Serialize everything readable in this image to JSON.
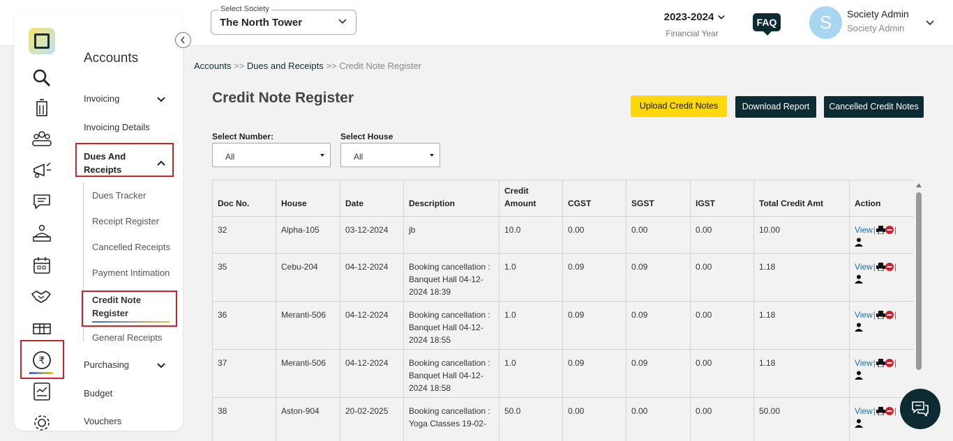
{
  "header": {
    "society_label": "Select Society",
    "society_value": "The North Tower",
    "financial_year": "2023-2024",
    "financial_year_label": "Financial Year",
    "faq_label": "FAQ",
    "avatar_initial": "S",
    "user_name": "Society Admin",
    "user_role": "Society Admin"
  },
  "sidebar": {
    "section_title": "Accounts",
    "items": {
      "invoicing": "Invoicing",
      "invoicing_details": "Invoicing Details",
      "dues_and_receipts": "Dues And Receipts",
      "dues_tracker": "Dues Tracker",
      "receipt_register": "Receipt Register",
      "cancelled_receipts": "Cancelled Receipts",
      "payment_intimation": "Payment Intimation",
      "credit_note_register": "Credit Note Register",
      "general_receipts": "General Receipts",
      "purchasing": "Purchasing",
      "budget": "Budget",
      "vouchers": "Vouchers"
    },
    "icons": [
      "search-icon",
      "building-icon",
      "members-icon",
      "announcement-icon",
      "chat-icon",
      "helpdesk-icon",
      "calendar-icon",
      "handshake-icon",
      "package-icon",
      "rupee-icon",
      "report-icon",
      "settings-icon"
    ]
  },
  "breadcrumb": {
    "accounts": "Accounts",
    "sep1": ">>",
    "dues": "Dues and Receipts",
    "sep2": ">>",
    "current": "Credit Note Register"
  },
  "page": {
    "title": "Credit Note Register",
    "upload_button": "Upload Credit Notes",
    "download_button": "Download Report",
    "cancelled_button": "Cancelled Credit Notes"
  },
  "filters": {
    "number_label": "Select Number:",
    "number_value": "All",
    "house_label": "Select House",
    "house_value": "All"
  },
  "table": {
    "headers": [
      "Doc No.",
      "House",
      "Date",
      "Description",
      "Credit Amount",
      "CGST",
      "SGST",
      "IGST",
      "Total Credit Amt",
      "Action"
    ],
    "action_view": "View",
    "action_sep": "|",
    "rows": [
      {
        "doc": "32",
        "house": "Alpha-105",
        "date": "03-12-2024",
        "desc": "jb",
        "credit": "10.0",
        "cgst": "0.00",
        "sgst": "0.00",
        "igst": "0.00",
        "total": "10.00"
      },
      {
        "doc": "35",
        "house": "Cebu-204",
        "date": "04-12-2024",
        "desc": "Booking cancellation : Banquet Hall 04-12-2024 18:39",
        "credit": "1.0",
        "cgst": "0.09",
        "sgst": "0.09",
        "igst": "0.00",
        "total": "1.18"
      },
      {
        "doc": "36",
        "house": "Meranti-506",
        "date": "04-12-2024",
        "desc": "Booking cancellation : Banquet Hall 04-12-2024 18:55",
        "credit": "1.0",
        "cgst": "0.09",
        "sgst": "0.09",
        "igst": "0.00",
        "total": "1.18"
      },
      {
        "doc": "37",
        "house": "Meranti-506",
        "date": "04-12-2024",
        "desc": "Booking cancellation : Banquet Hall 04-12-2024 18:58",
        "credit": "1.0",
        "cgst": "0.09",
        "sgst": "0.09",
        "igst": "0.00",
        "total": "1.18"
      },
      {
        "doc": "38",
        "house": "Aston-904",
        "date": "20-02-2025",
        "desc": "Booking cancellation : Yoga Classes 19-02-",
        "credit": "50.0",
        "cgst": "0.00",
        "sgst": "0.00",
        "igst": "0.00",
        "total": "50.00"
      }
    ]
  },
  "colors": {
    "brand_dark": "#0d2b32",
    "accent_yellow": "#ffd80a",
    "highlight_red": "#d0202e",
    "link_blue": "#1a6fb3"
  }
}
